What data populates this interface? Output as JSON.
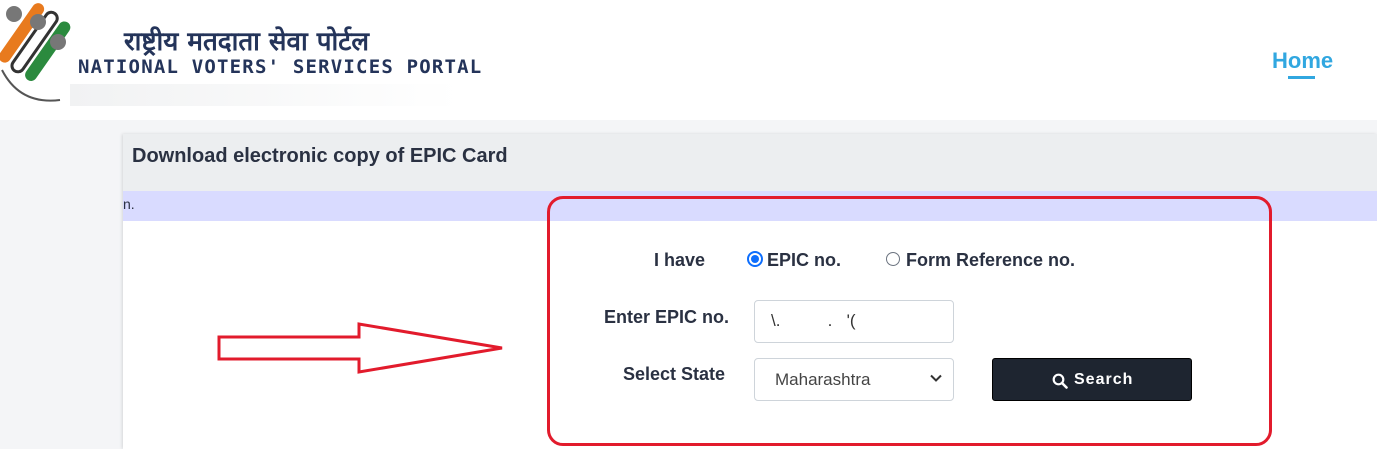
{
  "header": {
    "title_hindi": "राष्ट्रीय मतदाता सेवा पोर्टल",
    "title_english": "NATIONAL VOTERS' SERVICES PORTAL",
    "nav_home": "Home"
  },
  "card": {
    "title": "Download electronic copy of EPIC Card",
    "info_text": "n."
  },
  "form": {
    "i_have_label": "I have",
    "option_epic": "EPIC no.",
    "option_form_ref": "Form Reference no.",
    "selected_option": "EPIC no.",
    "epic_label": "Enter EPIC no.",
    "epic_value": "\\.          .   '(",
    "state_label": "Select State",
    "state_value": "Maharashtra",
    "search_label": "Search"
  },
  "icons": {
    "search": "search-icon",
    "dropdown": "chevron-down-icon",
    "annotation": "right-arrow-icon"
  },
  "colors": {
    "accent": "#31a7e0",
    "radio": "#0d6efd",
    "button": "#1e2530",
    "highlight": "#e21b2c",
    "info_bar": "#d9dbff"
  }
}
